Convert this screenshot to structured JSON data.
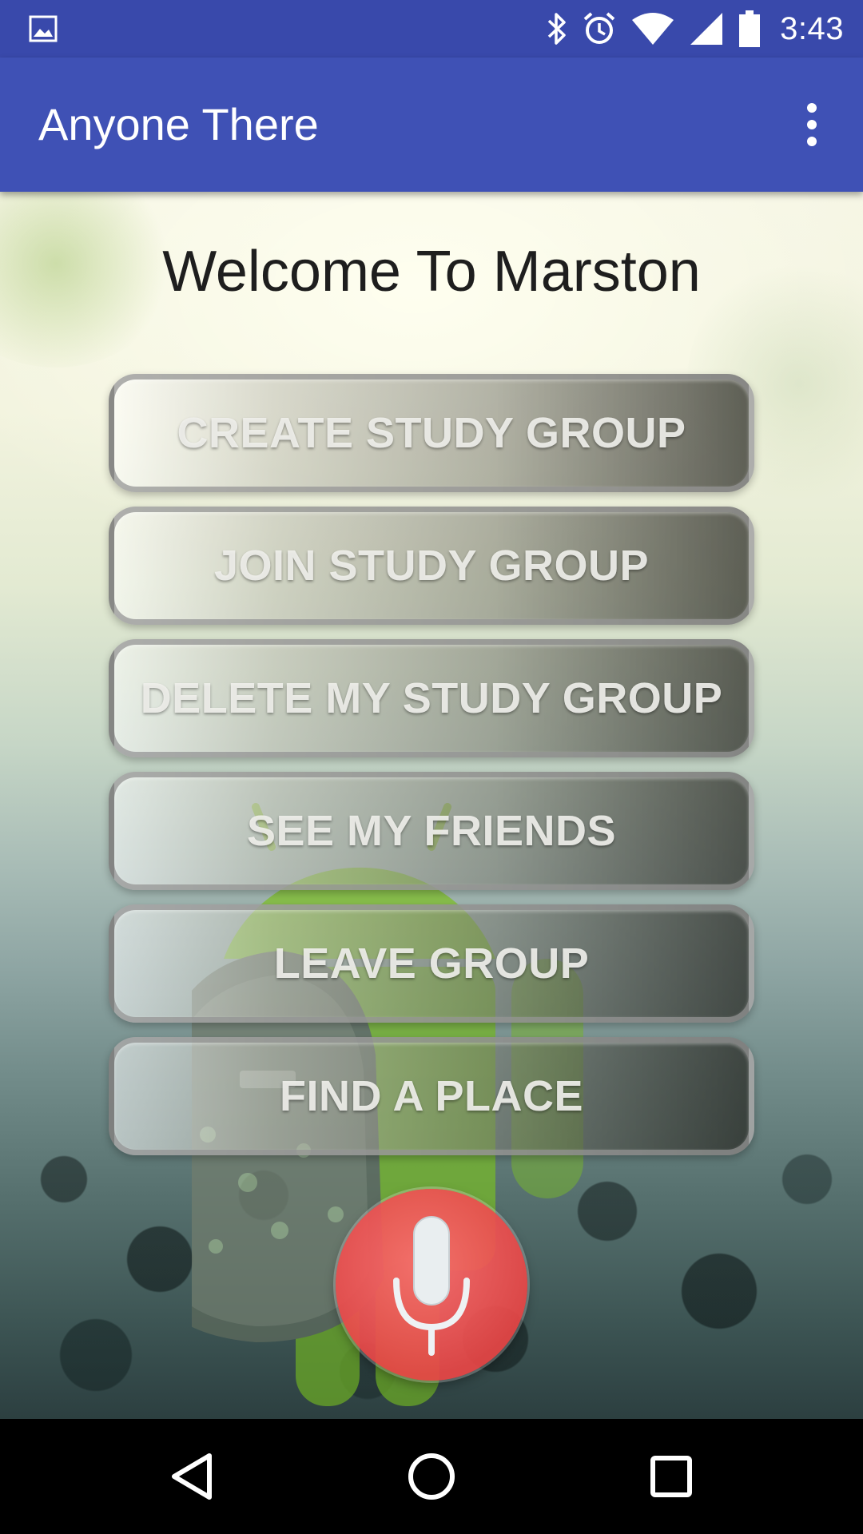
{
  "status_bar": {
    "time": "3:43",
    "icons": [
      "gallery-notification-icon",
      "bluetooth-icon",
      "alarm-icon",
      "wifi-icon",
      "cell-signal-icon",
      "battery-icon"
    ]
  },
  "app_bar": {
    "title": "Anyone There",
    "menu_icon": "overflow-menu-icon"
  },
  "main": {
    "welcome": "Welcome To Marston",
    "buttons": [
      {
        "label": "CREATE STUDY GROUP"
      },
      {
        "label": "JOIN STUDY GROUP"
      },
      {
        "label": "DELETE MY STUDY GROUP"
      },
      {
        "label": "SEE MY FRIENDS"
      },
      {
        "label": "LEAVE GROUP"
      },
      {
        "label": "FIND A PLACE"
      }
    ],
    "mic_button_icon": "microphone-icon"
  },
  "nav_bar": {
    "icons": [
      "back-icon",
      "home-icon",
      "recents-icon"
    ]
  },
  "colors": {
    "status_bar": "#3949ab",
    "app_bar": "#3f51b5",
    "mic_fab": "#e84646",
    "nav_bar": "#000000"
  }
}
